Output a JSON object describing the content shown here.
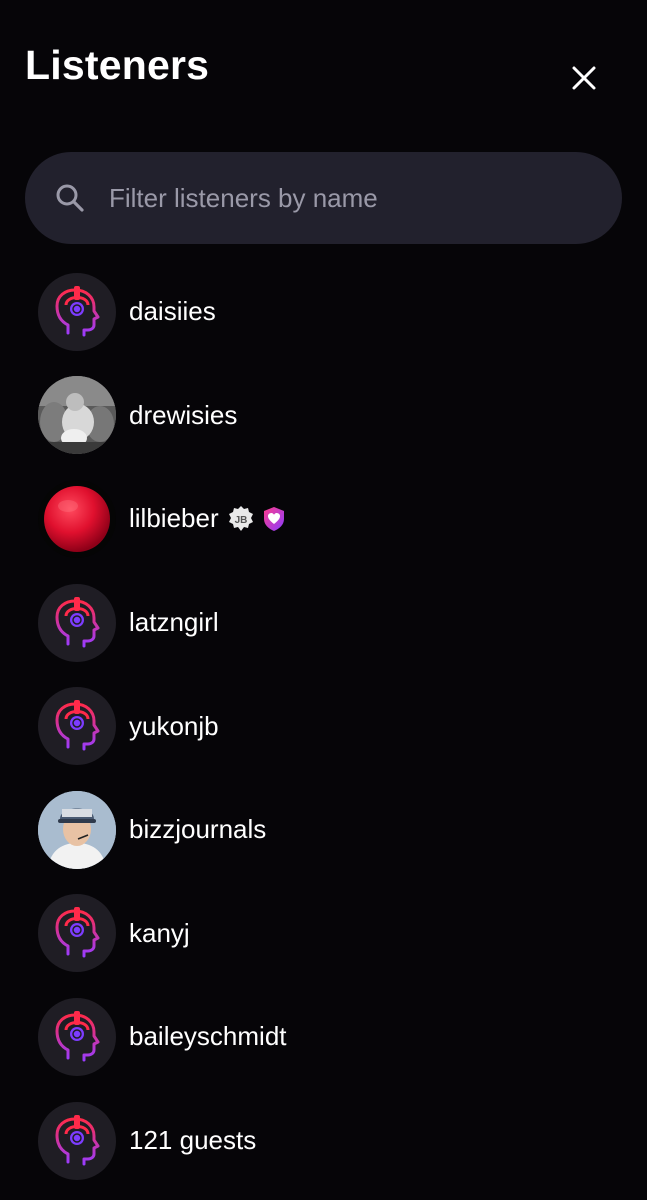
{
  "header": {
    "title": "Listeners",
    "close_icon": "close-icon"
  },
  "search": {
    "placeholder": "Filter listeners by name",
    "value": "",
    "icon": "search-icon"
  },
  "listeners": [
    {
      "name": "daisiies",
      "avatar": "default-headphones-avatar"
    },
    {
      "name": "drewisies",
      "avatar": "photo-avatar-bw"
    },
    {
      "name": "lilbieber",
      "avatar": "red-sphere-avatar",
      "badges": [
        "JB",
        "heart-shield-badge"
      ]
    },
    {
      "name": "latzngirl",
      "avatar": "default-headphones-avatar"
    },
    {
      "name": "yukonjb",
      "avatar": "default-headphones-avatar"
    },
    {
      "name": "bizzjournals",
      "avatar": "photo-avatar-cap"
    },
    {
      "name": "kanyj",
      "avatar": "default-headphones-avatar"
    },
    {
      "name": "baileyschmidt",
      "avatar": "default-headphones-avatar"
    },
    {
      "name": "121 guests",
      "avatar": "default-headphones-avatar"
    }
  ],
  "colors": {
    "background": "#060508",
    "search_bg": "#22212d",
    "avatar_bg": "#1f1d24",
    "accent_red": "#ff2a4a",
    "accent_purple": "#9a3cff"
  }
}
